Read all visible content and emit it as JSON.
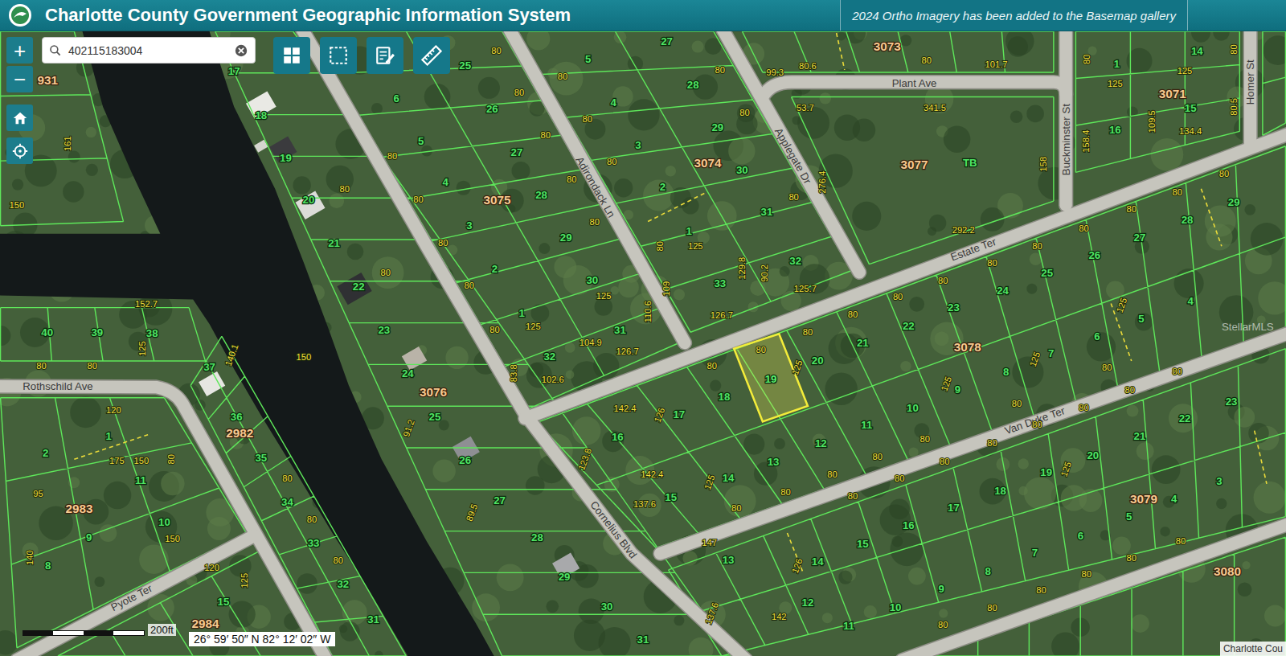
{
  "header": {
    "title": "Charlotte County Government Geographic Information System",
    "banner": "2024 Ortho Imagery has been added to the Basemap gallery"
  },
  "search": {
    "value": "402115183004"
  },
  "zoom": [
    "+",
    "−"
  ],
  "map": {
    "streets": [
      "Plant Ave",
      "Applegate Dr",
      "Adirondack Ln",
      "Buckminster St",
      "Homer St",
      "Estate Ter",
      "Van Dyke Ter",
      "Cornelius Blvd",
      "Rothschild Ave",
      "Pyote Ter"
    ],
    "blocks": [
      "3075",
      "3074",
      "3073",
      "3077",
      "3071",
      "3078",
      "3079",
      "3080",
      "3076",
      "2982",
      "2983",
      "2984",
      "931"
    ],
    "lots": [
      {
        "label": "17",
        "selected": false
      },
      {
        "label": "18",
        "selected": false
      },
      {
        "label": "19",
        "selected": false
      },
      {
        "label": "20",
        "selected": false
      },
      {
        "label": "21",
        "selected": false
      },
      {
        "label": "22",
        "selected": false
      },
      {
        "label": "23",
        "selected": false
      },
      {
        "label": "24",
        "selected": false
      },
      {
        "label": "25",
        "selected": false
      },
      {
        "label": "26",
        "selected": false
      },
      {
        "label": "27",
        "selected": false
      },
      {
        "label": "28",
        "selected": false
      },
      {
        "label": "29",
        "selected": false
      },
      {
        "label": "30",
        "selected": false
      },
      {
        "label": "31",
        "selected": false
      },
      {
        "label": "25",
        "selected": false
      },
      {
        "label": "26",
        "selected": false
      },
      {
        "label": "27",
        "selected": false
      },
      {
        "label": "28",
        "selected": false
      },
      {
        "label": "29",
        "selected": false
      },
      {
        "label": "30",
        "selected": false
      },
      {
        "label": "31",
        "selected": false
      },
      {
        "label": "32",
        "selected": false
      },
      {
        "label": "6",
        "selected": false
      },
      {
        "label": "5",
        "selected": false
      },
      {
        "label": "4",
        "selected": false
      },
      {
        "label": "3",
        "selected": false
      },
      {
        "label": "2",
        "selected": false
      },
      {
        "label": "1",
        "selected": false
      },
      {
        "label": "27",
        "selected": false
      },
      {
        "label": "28",
        "selected": false
      },
      {
        "label": "29",
        "selected": false
      },
      {
        "label": "30",
        "selected": false
      },
      {
        "label": "31",
        "selected": false
      },
      {
        "label": "32",
        "selected": false
      },
      {
        "label": "33",
        "selected": false
      },
      {
        "label": "5",
        "selected": false
      },
      {
        "label": "4",
        "selected": false
      },
      {
        "label": "3",
        "selected": false
      },
      {
        "label": "2",
        "selected": false
      },
      {
        "label": "1",
        "selected": false
      },
      {
        "label": "TB",
        "selected": false
      },
      {
        "label": "1",
        "selected": false
      },
      {
        "label": "14",
        "selected": false
      },
      {
        "label": "15",
        "selected": false
      },
      {
        "label": "16",
        "selected": false
      },
      {
        "label": "18",
        "selected": false
      },
      {
        "label": "19",
        "selected": true
      },
      {
        "label": "20",
        "selected": false
      },
      {
        "label": "21",
        "selected": false
      },
      {
        "label": "22",
        "selected": false
      },
      {
        "label": "23",
        "selected": false
      },
      {
        "label": "24",
        "selected": false
      },
      {
        "label": "25",
        "selected": false
      },
      {
        "label": "26",
        "selected": false
      },
      {
        "label": "27",
        "selected": false
      },
      {
        "label": "28",
        "selected": false
      },
      {
        "label": "29",
        "selected": false
      },
      {
        "label": "17",
        "selected": false
      },
      {
        "label": "16",
        "selected": false
      },
      {
        "label": "15",
        "selected": false
      },
      {
        "label": "14",
        "selected": false
      },
      {
        "label": "13",
        "selected": false
      },
      {
        "label": "12",
        "selected": false
      },
      {
        "label": "11",
        "selected": false
      },
      {
        "label": "10",
        "selected": false
      },
      {
        "label": "9",
        "selected": false
      },
      {
        "label": "8",
        "selected": false
      },
      {
        "label": "7",
        "selected": false
      },
      {
        "label": "6",
        "selected": false
      },
      {
        "label": "5",
        "selected": false
      },
      {
        "label": "4",
        "selected": false
      },
      {
        "label": "13",
        "selected": false
      },
      {
        "label": "14",
        "selected": false
      },
      {
        "label": "15",
        "selected": false
      },
      {
        "label": "16",
        "selected": false
      },
      {
        "label": "17",
        "selected": false
      },
      {
        "label": "18",
        "selected": false
      },
      {
        "label": "19",
        "selected": false
      },
      {
        "label": "20",
        "selected": false
      },
      {
        "label": "21",
        "selected": false
      },
      {
        "label": "22",
        "selected": false
      },
      {
        "label": "23",
        "selected": false
      },
      {
        "label": "12",
        "selected": false
      },
      {
        "label": "11",
        "selected": false
      },
      {
        "label": "10",
        "selected": false
      },
      {
        "label": "9",
        "selected": false
      },
      {
        "label": "8",
        "selected": false
      },
      {
        "label": "7",
        "selected": false
      },
      {
        "label": "6",
        "selected": false
      },
      {
        "label": "5",
        "selected": false
      },
      {
        "label": "4",
        "selected": false
      },
      {
        "label": "3",
        "selected": false
      },
      {
        "label": "40",
        "selected": false
      },
      {
        "label": "39",
        "selected": false
      },
      {
        "label": "38",
        "selected": false
      },
      {
        "label": "37",
        "selected": false
      },
      {
        "label": "36",
        "selected": false
      },
      {
        "label": "35",
        "selected": false
      },
      {
        "label": "34",
        "selected": false
      },
      {
        "label": "33",
        "selected": false
      },
      {
        "label": "32",
        "selected": false
      },
      {
        "label": "31",
        "selected": false
      },
      {
        "label": "1",
        "selected": false
      },
      {
        "label": "2",
        "selected": false
      },
      {
        "label": "11",
        "selected": false
      },
      {
        "label": "10",
        "selected": false
      },
      {
        "label": "9",
        "selected": false
      },
      {
        "label": "8",
        "selected": false
      },
      {
        "label": "15",
        "selected": false
      }
    ],
    "dimensions": [
      "80",
      "80",
      "80",
      "80",
      "80",
      "125",
      "125",
      "104.9",
      "102.6",
      "83.8",
      "80",
      "80",
      "80",
      "80",
      "80",
      "126.7",
      "110.6",
      "80",
      "80",
      "80",
      "80",
      "125",
      "109",
      "126.7",
      "129.8",
      "90.2",
      "125.7",
      "80",
      "80",
      "80",
      "53.7",
      "341.5",
      "276.4",
      "292.2",
      "158",
      "99.3",
      "80.6",
      "80",
      "101.7",
      "125",
      "125",
      "158.4",
      "109.5",
      "134.4",
      "80",
      "80.5",
      "80",
      "80",
      "80",
      "80",
      "80",
      "80",
      "80",
      "80",
      "80",
      "80",
      "80",
      "80",
      "80",
      "125",
      "142.4",
      "126",
      "123.8",
      "142.4",
      "137.6",
      "125",
      "80",
      "80",
      "80",
      "80",
      "80",
      "80",
      "80",
      "125",
      "125",
      "125",
      "80",
      "80",
      "80",
      "80",
      "80",
      "80",
      "80",
      "80",
      "147",
      "126",
      "137.6",
      "142",
      "125",
      "80",
      "80",
      "80",
      "80",
      "80",
      "80",
      "152.7",
      "125",
      "80",
      "80",
      "140.1",
      "150",
      "120",
      "175",
      "150",
      "80",
      "150",
      "95",
      "140",
      "120",
      "125",
      "80",
      "80",
      "80",
      "161",
      "150",
      "91.2",
      "89.5",
      "80",
      "80"
    ]
  },
  "watermark": "StellarMLS",
  "scale": "200ft",
  "coordinates": "26° 59′ 50″ N 82° 12′ 02″ W",
  "attribution": "Charlotte Cou"
}
